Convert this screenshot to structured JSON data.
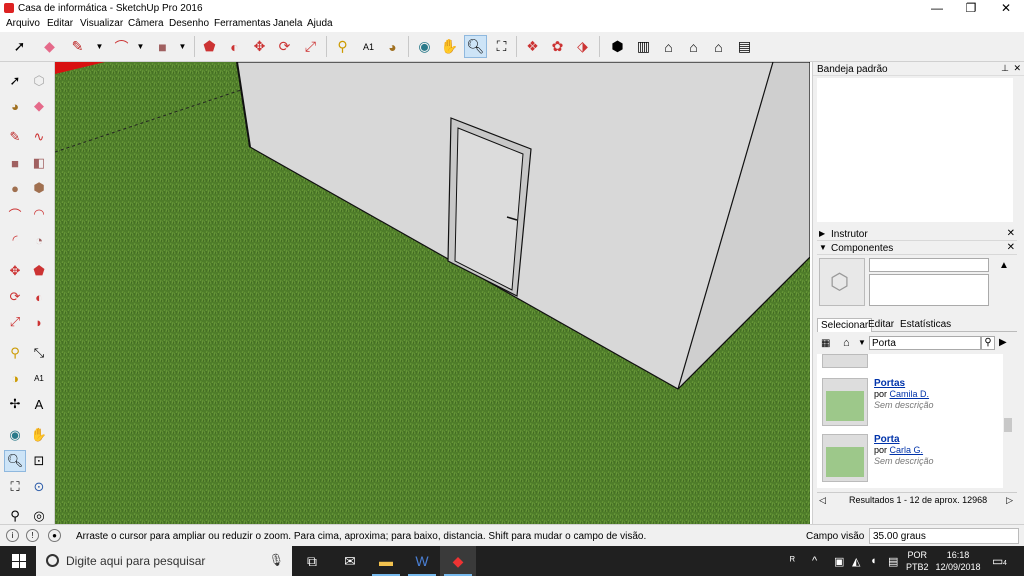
{
  "window": {
    "title": "Casa de informática - SketchUp Pro 2016",
    "minimize": "—",
    "restore": "❐",
    "close": "✕"
  },
  "menu": [
    "Arquivo",
    "Editar",
    "Visualizar",
    "Câmera",
    "Desenho",
    "Ferramentas",
    "Janela",
    "Ajuda"
  ],
  "tray": {
    "title": "Bandeja padrão",
    "panels": {
      "instructor": "Instrutor",
      "components": "Componentes"
    },
    "tabs": [
      "Selecionar",
      "Editar",
      "Estatísticas"
    ],
    "search_value": "Porta",
    "results": [
      {
        "name": "Portas",
        "by_prefix": "por",
        "author": "Camila D.",
        "desc": "Sem descrição"
      },
      {
        "name": "Porta",
        "by_prefix": "por",
        "author": "Carla G.",
        "desc": "Sem descrição"
      }
    ],
    "results_footer": "Resultados 1 - 12 de aprox. 12968"
  },
  "status": {
    "hint": "Arraste o cursor para ampliar ou reduzir o zoom. Para cima, aproxima; para baixo, distancia. Shift para mudar o campo de visão.",
    "value_label": "Campo visão",
    "value": "35.00 graus"
  },
  "taskbar": {
    "search_placeholder": "Digite aqui para pesquisar",
    "lang_line1": "POR",
    "lang_line2": "PTB2",
    "time": "16:18",
    "date": "12/09/2018",
    "notifications": "4"
  },
  "colors": {
    "grass": "#4f7d2a",
    "wall": "#d9d9d9",
    "accent_active": "#cde4f7",
    "taskbar": "#202020"
  }
}
